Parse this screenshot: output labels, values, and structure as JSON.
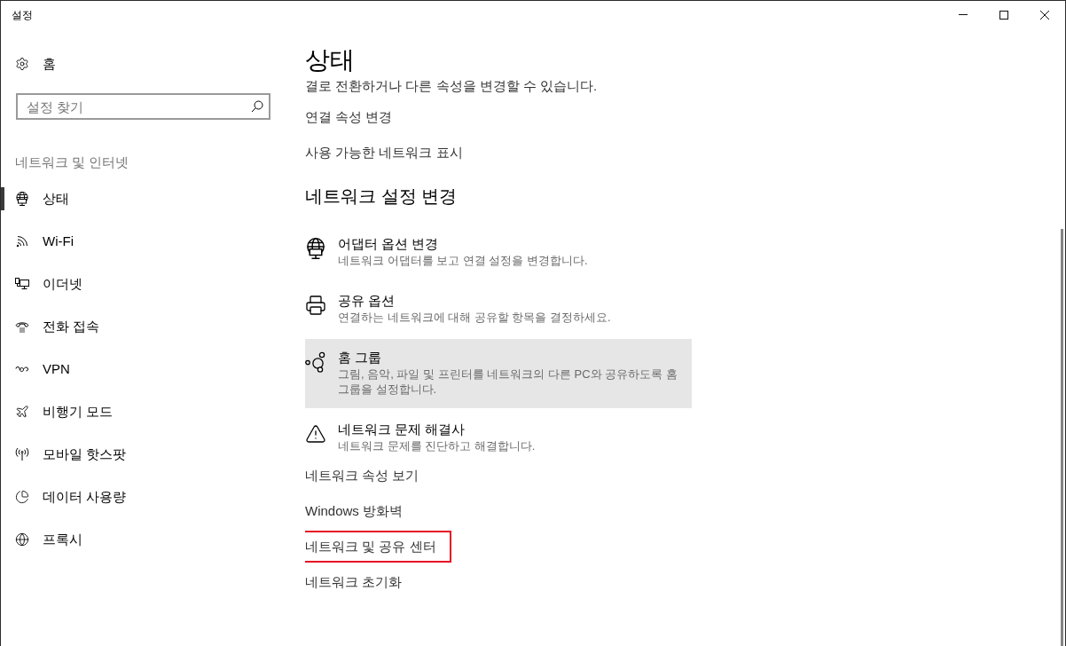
{
  "window": {
    "title": "설정"
  },
  "sidebar": {
    "home": "홈",
    "search": {
      "placeholder": "설정 찾기"
    },
    "section_label": "네트워크 및 인터넷",
    "items": [
      {
        "kind": "status",
        "label": "상태",
        "selected": true
      },
      {
        "kind": "wifi",
        "label": "Wi-Fi",
        "selected": false
      },
      {
        "kind": "ethernet",
        "label": "이더넷",
        "selected": false
      },
      {
        "kind": "dialup",
        "label": "전화 접속",
        "selected": false
      },
      {
        "kind": "vpn",
        "label": "VPN",
        "selected": false
      },
      {
        "kind": "airplane",
        "label": "비행기 모드",
        "selected": false
      },
      {
        "kind": "hotspot",
        "label": "모바일 핫스팟",
        "selected": false
      },
      {
        "kind": "data",
        "label": "데이터 사용량",
        "selected": false
      },
      {
        "kind": "proxy",
        "label": "프록시",
        "selected": false
      }
    ]
  },
  "main": {
    "title": "상태",
    "partial_text": "결로 전환하거나 다른 속성을 변경할 수 있습니다.",
    "links": [
      "연결 속성 변경",
      "사용 가능한 네트워크 표시"
    ],
    "section_title": "네트워크 설정 변경",
    "options": [
      {
        "kind": "adapter",
        "title": "어댑터 옵션 변경",
        "description": "네트워크 어댑터를 보고 연결 설정을 변경합니다.",
        "hovered": false
      },
      {
        "kind": "sharing",
        "title": "공유 옵션",
        "description": "연결하는 네트워크에 대해 공유할 항목을 결정하세요.",
        "hovered": false
      },
      {
        "kind": "homegroup",
        "title": "홈 그룹",
        "description": "그림, 음악, 파일 및 프린터를 네트워크의 다른 PC와 공유하도록 홈 그룹을 설정합니다.",
        "hovered": true
      },
      {
        "kind": "troubleshoot",
        "title": "네트워크 문제 해결사",
        "description": "네트워크 문제를 진단하고 해결합니다.",
        "hovered": false
      }
    ],
    "more_links": [
      {
        "label": "네트워크 속성 보기",
        "highlighted": false
      },
      {
        "label": "Windows 방화벽",
        "highlighted": false
      },
      {
        "label": "네트워크 및 공유 센터",
        "highlighted": true
      },
      {
        "label": "네트워크 초기화",
        "highlighted": false
      }
    ]
  }
}
